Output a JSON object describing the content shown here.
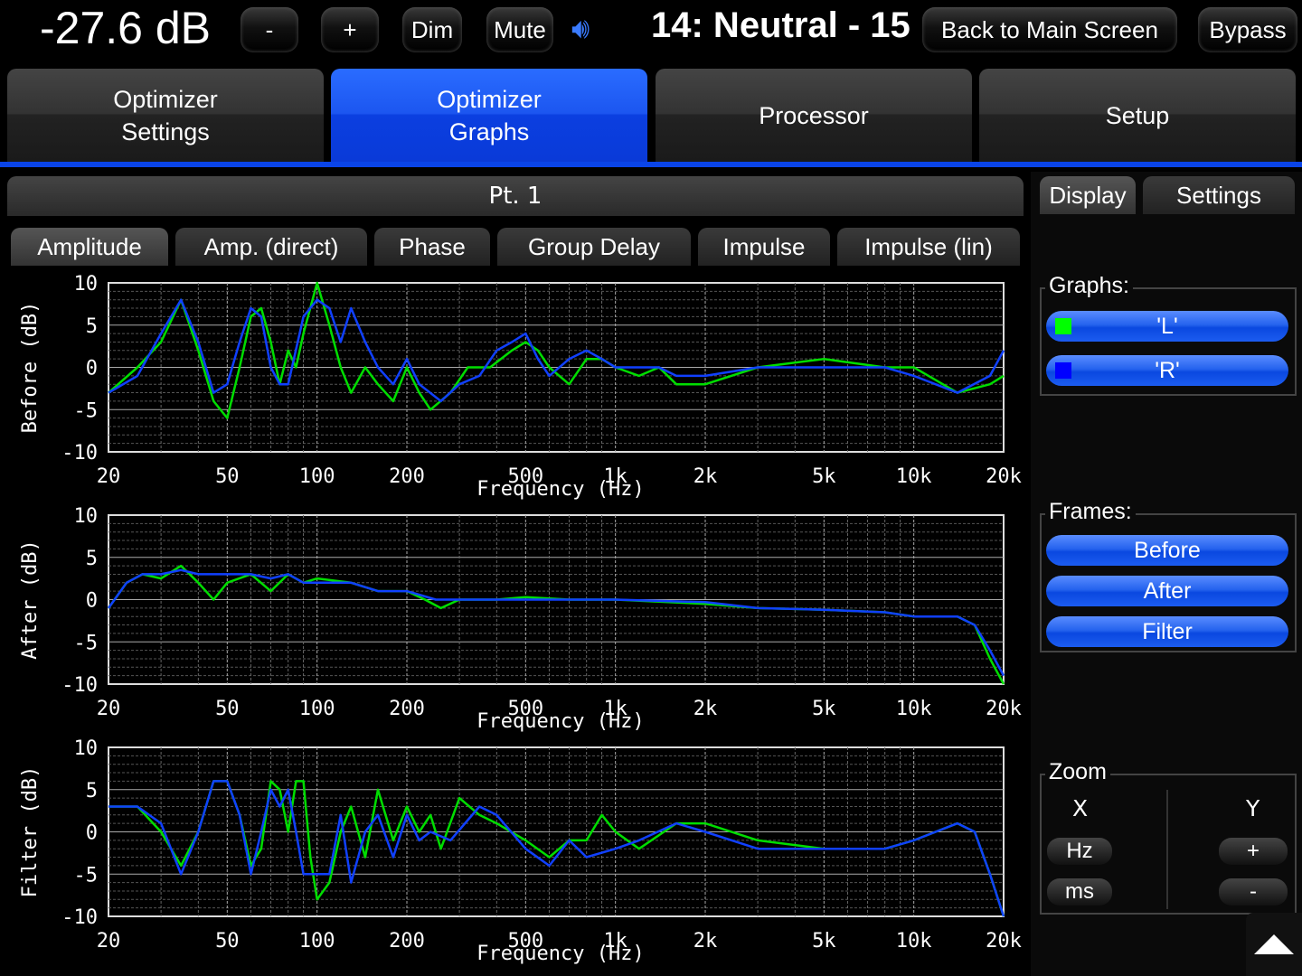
{
  "header": {
    "volume": "-27.6 dB",
    "minus": "-",
    "plus": "+",
    "dim": "Dim",
    "mute": "Mute",
    "preset": "14: Neutral - 15",
    "back": "Back to Main Screen",
    "bypass": "Bypass"
  },
  "tabs": [
    {
      "label": "Optimizer\nSettings"
    },
    {
      "label": "Optimizer\nGraphs"
    },
    {
      "label": "Processor"
    },
    {
      "label": "Setup"
    }
  ],
  "point": "Pt. 1",
  "subtabs": [
    "Amplitude",
    "Amp. (direct)",
    "Phase",
    "Group Delay",
    "Impulse",
    "Impulse (lin)"
  ],
  "side": {
    "tabs": [
      "Display",
      "Settings"
    ],
    "graphs_label": "Graphs:",
    "graphs": [
      {
        "label": "'L'",
        "color": "#00ff00"
      },
      {
        "label": "'R'",
        "color": "#0000ff"
      }
    ],
    "frames_label": "Frames:",
    "frames": [
      "Before",
      "After",
      "Filter"
    ],
    "zoom_label": "Zoom",
    "x": "X",
    "y": "Y",
    "hz": "Hz",
    "ms": "ms",
    "yplus": "+",
    "yminus": "-"
  },
  "chart_data": [
    {
      "type": "line",
      "ylabel": "Before (dB)",
      "xlabel": "Frequency (Hz)",
      "xscale": "log",
      "xlim": [
        20,
        20000
      ],
      "ylim": [
        -10,
        10
      ],
      "yticks": [
        "10",
        "5",
        "0",
        "-5",
        "-10"
      ],
      "xticks": [
        "20",
        "50",
        "100",
        "200",
        "500",
        "1k",
        "2k",
        "5k",
        "10k",
        "20k"
      ],
      "series": [
        {
          "name": "L",
          "color": "#00dd00",
          "points": [
            [
              20,
              -3
            ],
            [
              25,
              0
            ],
            [
              30,
              3
            ],
            [
              35,
              8
            ],
            [
              40,
              2
            ],
            [
              45,
              -4
            ],
            [
              50,
              -6
            ],
            [
              55,
              0
            ],
            [
              60,
              6
            ],
            [
              65,
              7
            ],
            [
              70,
              3
            ],
            [
              75,
              -2
            ],
            [
              80,
              2
            ],
            [
              85,
              0
            ],
            [
              90,
              4
            ],
            [
              100,
              10
            ],
            [
              110,
              5
            ],
            [
              120,
              0
            ],
            [
              130,
              -3
            ],
            [
              145,
              0
            ],
            [
              160,
              -2
            ],
            [
              180,
              -4
            ],
            [
              200,
              0
            ],
            [
              220,
              -3
            ],
            [
              240,
              -5
            ],
            [
              280,
              -3
            ],
            [
              320,
              0
            ],
            [
              380,
              0
            ],
            [
              450,
              2
            ],
            [
              500,
              3
            ],
            [
              550,
              2
            ],
            [
              600,
              0
            ],
            [
              700,
              -2
            ],
            [
              800,
              1
            ],
            [
              900,
              1
            ],
            [
              1000,
              0
            ],
            [
              1200,
              -1
            ],
            [
              1400,
              0
            ],
            [
              1600,
              -2
            ],
            [
              2000,
              -2
            ],
            [
              3000,
              0
            ],
            [
              5000,
              1
            ],
            [
              8000,
              0
            ],
            [
              10000,
              0
            ],
            [
              14000,
              -3
            ],
            [
              18000,
              -2
            ],
            [
              20000,
              -1
            ]
          ]
        },
        {
          "name": "R",
          "color": "#1040ff",
          "points": [
            [
              20,
              -3
            ],
            [
              25,
              -1
            ],
            [
              30,
              4
            ],
            [
              35,
              8
            ],
            [
              40,
              3
            ],
            [
              45,
              -3
            ],
            [
              50,
              -2
            ],
            [
              55,
              3
            ],
            [
              60,
              7
            ],
            [
              65,
              6
            ],
            [
              70,
              0
            ],
            [
              75,
              -2
            ],
            [
              80,
              -2
            ],
            [
              90,
              6
            ],
            [
              100,
              8
            ],
            [
              110,
              7
            ],
            [
              120,
              3
            ],
            [
              130,
              7
            ],
            [
              145,
              3
            ],
            [
              160,
              0
            ],
            [
              180,
              -2
            ],
            [
              200,
              1
            ],
            [
              220,
              -2
            ],
            [
              260,
              -4
            ],
            [
              300,
              -2
            ],
            [
              350,
              -1
            ],
            [
              400,
              2
            ],
            [
              450,
              3
            ],
            [
              500,
              4
            ],
            [
              550,
              1
            ],
            [
              600,
              -1
            ],
            [
              700,
              1
            ],
            [
              800,
              2
            ],
            [
              900,
              1
            ],
            [
              1000,
              0
            ],
            [
              1200,
              0
            ],
            [
              1400,
              0
            ],
            [
              1600,
              -1
            ],
            [
              2000,
              -1
            ],
            [
              3000,
              0
            ],
            [
              5000,
              0
            ],
            [
              8000,
              0
            ],
            [
              10000,
              -1
            ],
            [
              14000,
              -3
            ],
            [
              18000,
              -1
            ],
            [
              20000,
              2
            ]
          ]
        }
      ]
    },
    {
      "type": "line",
      "ylabel": "After (dB)",
      "xlabel": "Frequency (Hz)",
      "xscale": "log",
      "xlim": [
        20,
        20000
      ],
      "ylim": [
        -10,
        10
      ],
      "yticks": [
        "10",
        "5",
        "0",
        "-5",
        "-10"
      ],
      "xticks": [
        "20",
        "50",
        "100",
        "200",
        "500",
        "1k",
        "2k",
        "5k",
        "10k",
        "20k"
      ],
      "series": [
        {
          "name": "L",
          "color": "#00dd00",
          "points": [
            [
              20,
              -1
            ],
            [
              23,
              2
            ],
            [
              26,
              3
            ],
            [
              30,
              2.5
            ],
            [
              35,
              4
            ],
            [
              40,
              2
            ],
            [
              45,
              0
            ],
            [
              50,
              2
            ],
            [
              60,
              3
            ],
            [
              70,
              1
            ],
            [
              80,
              3
            ],
            [
              90,
              2
            ],
            [
              100,
              2.5
            ],
            [
              130,
              2
            ],
            [
              160,
              1
            ],
            [
              200,
              1
            ],
            [
              230,
              0
            ],
            [
              260,
              -1
            ],
            [
              300,
              0
            ],
            [
              400,
              0
            ],
            [
              500,
              0.3
            ],
            [
              700,
              0
            ],
            [
              1000,
              0
            ],
            [
              2000,
              -0.5
            ],
            [
              3000,
              -1
            ],
            [
              5000,
              -1.2
            ],
            [
              8000,
              -1.5
            ],
            [
              10000,
              -2
            ],
            [
              14000,
              -2
            ],
            [
              16000,
              -3
            ],
            [
              18000,
              -7
            ],
            [
              20000,
              -10
            ]
          ]
        },
        {
          "name": "R",
          "color": "#1040ff",
          "points": [
            [
              20,
              -1
            ],
            [
              23,
              2
            ],
            [
              26,
              3
            ],
            [
              30,
              3
            ],
            [
              35,
              3.5
            ],
            [
              40,
              3
            ],
            [
              50,
              3
            ],
            [
              60,
              3
            ],
            [
              70,
              2.5
            ],
            [
              80,
              3
            ],
            [
              90,
              2
            ],
            [
              100,
              2
            ],
            [
              130,
              2
            ],
            [
              160,
              1
            ],
            [
              200,
              1
            ],
            [
              250,
              0
            ],
            [
              300,
              0
            ],
            [
              400,
              0
            ],
            [
              500,
              0
            ],
            [
              700,
              0
            ],
            [
              1000,
              0
            ],
            [
              2000,
              -0.3
            ],
            [
              3000,
              -1
            ],
            [
              5000,
              -1.2
            ],
            [
              8000,
              -1.5
            ],
            [
              10000,
              -2
            ],
            [
              14000,
              -2
            ],
            [
              16000,
              -3
            ],
            [
              18000,
              -6
            ],
            [
              20000,
              -9
            ]
          ]
        }
      ]
    },
    {
      "type": "line",
      "ylabel": "Filter (dB)",
      "xlabel": "Frequency (Hz)",
      "xscale": "log",
      "xlim": [
        20,
        20000
      ],
      "ylim": [
        -10,
        10
      ],
      "yticks": [
        "10",
        "5",
        "0",
        "-5",
        "-10"
      ],
      "xticks": [
        "20",
        "50",
        "100",
        "200",
        "500",
        "1k",
        "2k",
        "5k",
        "10k",
        "20k"
      ],
      "series": [
        {
          "name": "L",
          "color": "#00dd00",
          "points": [
            [
              20,
              3
            ],
            [
              25,
              3
            ],
            [
              30,
              0
            ],
            [
              35,
              -4
            ],
            [
              40,
              0
            ],
            [
              45,
              6
            ],
            [
              50,
              6
            ],
            [
              55,
              2
            ],
            [
              60,
              -4
            ],
            [
              65,
              -2
            ],
            [
              70,
              6
            ],
            [
              75,
              5
            ],
            [
              80,
              0
            ],
            [
              85,
              6
            ],
            [
              90,
              6
            ],
            [
              95,
              -3
            ],
            [
              100,
              -8
            ],
            [
              110,
              -6
            ],
            [
              120,
              0
            ],
            [
              130,
              3
            ],
            [
              145,
              -3
            ],
            [
              160,
              5
            ],
            [
              180,
              -1
            ],
            [
              200,
              3
            ],
            [
              220,
              0
            ],
            [
              240,
              2
            ],
            [
              260,
              -2
            ],
            [
              300,
              4
            ],
            [
              350,
              2
            ],
            [
              400,
              1
            ],
            [
              500,
              -1
            ],
            [
              600,
              -3
            ],
            [
              700,
              -1
            ],
            [
              800,
              -1
            ],
            [
              900,
              2
            ],
            [
              1000,
              0
            ],
            [
              1200,
              -2
            ],
            [
              1600,
              1
            ],
            [
              2000,
              1
            ],
            [
              3000,
              -1
            ],
            [
              5000,
              -2
            ],
            [
              8000,
              -2
            ],
            [
              10000,
              -1
            ],
            [
              14000,
              1
            ],
            [
              16000,
              0
            ],
            [
              18000,
              -5
            ],
            [
              20000,
              -10
            ]
          ]
        },
        {
          "name": "R",
          "color": "#1040ff",
          "points": [
            [
              20,
              3
            ],
            [
              25,
              3
            ],
            [
              30,
              1
            ],
            [
              35,
              -5
            ],
            [
              40,
              0
            ],
            [
              45,
              6
            ],
            [
              50,
              6
            ],
            [
              55,
              2
            ],
            [
              60,
              -5
            ],
            [
              65,
              0
            ],
            [
              70,
              5
            ],
            [
              75,
              3
            ],
            [
              80,
              5
            ],
            [
              85,
              0
            ],
            [
              90,
              -5
            ],
            [
              100,
              -5
            ],
            [
              110,
              -5
            ],
            [
              120,
              2
            ],
            [
              130,
              -6
            ],
            [
              145,
              0
            ],
            [
              160,
              2
            ],
            [
              180,
              -3
            ],
            [
              200,
              2
            ],
            [
              220,
              -1
            ],
            [
              240,
              0
            ],
            [
              280,
              -1
            ],
            [
              350,
              3
            ],
            [
              400,
              2
            ],
            [
              500,
              -2
            ],
            [
              600,
              -4
            ],
            [
              700,
              -1
            ],
            [
              800,
              -3
            ],
            [
              1000,
              -2
            ],
            [
              1200,
              -1
            ],
            [
              1600,
              1
            ],
            [
              2000,
              0
            ],
            [
              3000,
              -2
            ],
            [
              5000,
              -2
            ],
            [
              8000,
              -2
            ],
            [
              10000,
              -1
            ],
            [
              14000,
              1
            ],
            [
              16000,
              0
            ],
            [
              18000,
              -5
            ],
            [
              20000,
              -10
            ]
          ]
        }
      ]
    }
  ]
}
